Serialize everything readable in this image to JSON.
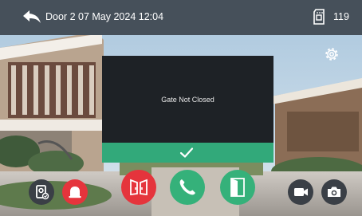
{
  "status_bar": {
    "door": "Door 2",
    "datetime": "07 May 2024 12:04",
    "storage_count": "119",
    "back_icon": "back-arrow-icon",
    "storage_icon": "sd-card-icon"
  },
  "dialog": {
    "message": "Gate Not Closed",
    "confirm_icon": "checkmark-icon"
  },
  "controls": [
    {
      "id": "monitor",
      "icon": "monitor-camera-icon"
    },
    {
      "id": "alarm",
      "icon": "bell-icon"
    },
    {
      "id": "unlock",
      "icon": "double-door-icon"
    },
    {
      "id": "answer",
      "icon": "phone-icon"
    },
    {
      "id": "gate",
      "icon": "gate-door-icon"
    },
    {
      "id": "record",
      "icon": "video-camera-icon"
    },
    {
      "id": "snapshot",
      "icon": "camera-icon"
    }
  ],
  "colors": {
    "accent_green": "#35b17a",
    "alert_red": "#e5343c",
    "status_bar": "#46505a"
  }
}
